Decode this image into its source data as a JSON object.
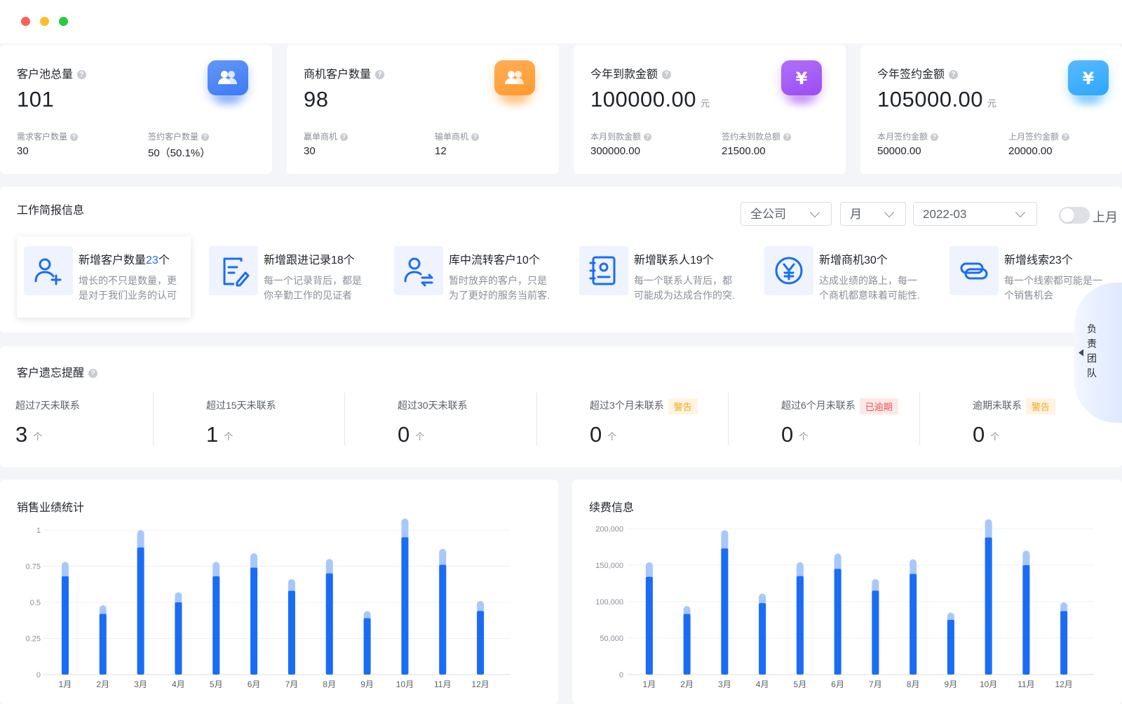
{
  "window": {
    "controls": [
      "close",
      "minimize",
      "maximize"
    ]
  },
  "stats": [
    {
      "title": "客户池总量",
      "value": "101",
      "unit": "",
      "icon": "users-icon",
      "color": "#3d7cf5",
      "subs": [
        {
          "label": "需求客户数量",
          "value": "30"
        },
        {
          "label": "签约客户数量",
          "value": "50（50.1%）"
        }
      ]
    },
    {
      "title": "商机客户数量",
      "value": "98",
      "unit": "",
      "icon": "chat-users-icon",
      "color": "#ff9a2e",
      "subs": [
        {
          "label": "赢单商机",
          "value": "30"
        },
        {
          "label": "输单商机",
          "value": "12"
        }
      ]
    },
    {
      "title": "今年到款金额",
      "value": "100000.00",
      "unit": "元",
      "icon": "yen-wallet-icon",
      "color": "#9c4df4",
      "subs": [
        {
          "label": "本月到款金额",
          "value": "300000.00"
        },
        {
          "label": "签约未到款总额",
          "value": "21500.00"
        }
      ]
    },
    {
      "title": "今年签约金额",
      "value": "105000.00",
      "unit": "元",
      "icon": "yen-book-icon",
      "color": "#2ea8ff",
      "subs": [
        {
          "label": "本月签约金额",
          "value": "50000.00"
        },
        {
          "label": "上月签约金额",
          "value": "20000.00"
        }
      ]
    }
  ],
  "work": {
    "title": "工作简报信息",
    "filters": {
      "company": "全公司",
      "period": "月",
      "date": "2022-03"
    },
    "toggle_label": "上月",
    "items": [
      {
        "prefix": "新增客户数量",
        "highlight": "23",
        "suffix": "个",
        "desc": "增长的不只是数量，更是对于我们业务的认可",
        "icon": "add-user-icon"
      },
      {
        "prefix": "新增跟进记录18个",
        "highlight": "",
        "suffix": "",
        "desc": "每一个记录背后，都是你辛勤工作的见证者",
        "icon": "edit-record-icon"
      },
      {
        "prefix": "库中流转客户10个",
        "highlight": "",
        "suffix": "",
        "desc": "暂时放弃的客户，只是为了更好的服务当前客.",
        "icon": "transfer-user-icon"
      },
      {
        "prefix": "新增联系人19个",
        "highlight": "",
        "suffix": "",
        "desc": "每一个联系人背后，都可能成为达成合作的突.",
        "icon": "contact-book-icon"
      },
      {
        "prefix": "新增商机30个",
        "highlight": "",
        "suffix": "",
        "desc": "达成业绩的路上，每一个商机都意味着可能性.",
        "icon": "yen-circle-icon"
      },
      {
        "prefix": "新增线索23个",
        "highlight": "",
        "suffix": "",
        "desc": "每一个线索都可能是一个销售机会",
        "icon": "link-clue-icon"
      }
    ]
  },
  "reminder": {
    "title": "客户遗忘提醒",
    "items": [
      {
        "label": "超过7天未联系",
        "value": "3",
        "unit": "个",
        "badge": "",
        "badge_type": ""
      },
      {
        "label": "超过15天未联系",
        "value": "1",
        "unit": "个",
        "badge": "",
        "badge_type": ""
      },
      {
        "label": "超过30天未联系",
        "value": "0",
        "unit": "个",
        "badge": "",
        "badge_type": ""
      },
      {
        "label": "超过3个月未联系",
        "value": "0",
        "unit": "个",
        "badge": "警告",
        "badge_type": "warn"
      },
      {
        "label": "超过6个月未联系",
        "value": "0",
        "unit": "个",
        "badge": "已逾期",
        "badge_type": "over"
      },
      {
        "label": "逾期未联系",
        "value": "0",
        "unit": "个",
        "badge": "警告",
        "badge_type": "warn"
      }
    ]
  },
  "side_tab": {
    "label": "负责团队"
  },
  "chart_data": [
    {
      "type": "bar",
      "title": "销售业绩统计",
      "categories": [
        "1月",
        "2月",
        "3月",
        "4月",
        "5月",
        "6月",
        "7月",
        "8月",
        "9月",
        "10月",
        "11月",
        "12月"
      ],
      "yticks": [
        "0",
        "0.25",
        "0.5",
        "0.75",
        "1"
      ],
      "ylim": [
        0,
        1
      ],
      "series": [
        {
          "values": [
            0.78,
            0.48,
            1.0,
            0.57,
            0.78,
            0.84,
            0.66,
            0.8,
            0.44,
            1.08,
            0.87,
            0.51
          ]
        },
        {
          "values": [
            0.68,
            0.42,
            0.88,
            0.5,
            0.68,
            0.74,
            0.58,
            0.7,
            0.39,
            0.95,
            0.76,
            0.44
          ]
        }
      ]
    },
    {
      "type": "bar",
      "title": "续费信息",
      "categories": [
        "1月",
        "2月",
        "3月",
        "4月",
        "5月",
        "6月",
        "7月",
        "8月",
        "9月",
        "10月",
        "11月",
        "12月"
      ],
      "yticks": [
        "0",
        "50,000",
        "100,000",
        "150,000",
        "200,000"
      ],
      "ylim": [
        0,
        200000
      ],
      "series": [
        {
          "values": [
            154000,
            94000,
            198000,
            111000,
            154000,
            166000,
            131000,
            158000,
            85000,
            213000,
            170000,
            99000
          ]
        },
        {
          "values": [
            134000,
            83000,
            173000,
            98000,
            135000,
            145000,
            115000,
            138000,
            75000,
            188000,
            150000,
            87000
          ]
        }
      ]
    }
  ]
}
